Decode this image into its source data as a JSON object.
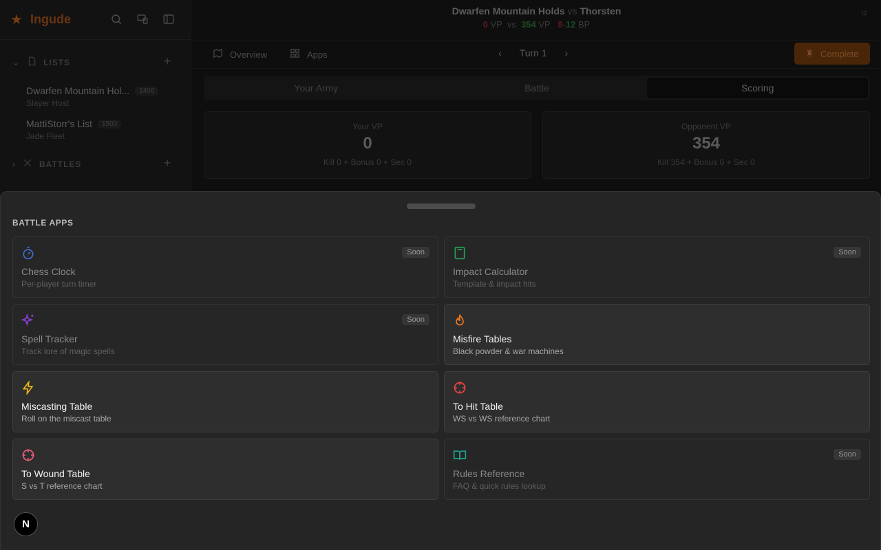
{
  "app": {
    "name": "Ingude"
  },
  "sidebar": {
    "lists_label": "LISTS",
    "battles_label": "BATTLES",
    "lists": [
      {
        "name": "Dwarfen Mountain Hol...",
        "points": "1400",
        "sub": "Slayer Host"
      },
      {
        "name": "MattiStorr's List",
        "points": "1500",
        "sub": "Jade Fleet"
      }
    ]
  },
  "match": {
    "player": "Dwarfen Mountain Holds",
    "vs": "vs",
    "opponent": "Thorsten",
    "your_vp": "0",
    "vp_unit": "VP",
    "vs_small": "vs",
    "opp_vp": "354",
    "bp_left": "8",
    "bp_sep": "-",
    "bp_right": "12",
    "bp_unit": "BP"
  },
  "toolbar": {
    "overview": "Overview",
    "apps": "Apps",
    "turn": "Turn 1",
    "complete": "Complete"
  },
  "tabs": [
    "Your Army",
    "Battle",
    "Scoring"
  ],
  "scoring": {
    "your_label": "Your VP",
    "your_value": "0",
    "your_break": "Kill 0 + Bonus 0 + Sec 0",
    "opp_label": "Opponent VP",
    "opp_value": "354",
    "opp_break": "Kill 354 + Bonus 0 + Sec 0"
  },
  "sheet": {
    "title": "BATTLE APPS",
    "soon_label": "Soon",
    "apps": [
      {
        "title": "Chess Clock",
        "sub": "Per-player turn timer",
        "icon": "stopwatch-icon",
        "color": "#3b6fd8",
        "soon": true
      },
      {
        "title": "Impact Calculator",
        "sub": "Template & impact hits",
        "icon": "calculator-icon",
        "color": "#22a355",
        "soon": true
      },
      {
        "title": "Spell Tracker",
        "sub": "Track lore of magic spells",
        "icon": "sparkles-icon",
        "color": "#8a3fd0",
        "soon": true
      },
      {
        "title": "Misfire Tables",
        "sub": "Black powder & war machines",
        "icon": "flame-icon",
        "color": "#f07a1e",
        "soon": false
      },
      {
        "title": "Miscasting Table",
        "sub": "Roll on the miscast table",
        "icon": "lightning-icon",
        "color": "#f0b81a",
        "soon": false
      },
      {
        "title": "To Hit Table",
        "sub": "WS vs WS reference chart",
        "icon": "crosshair-icon",
        "color": "#ef4444",
        "soon": false
      },
      {
        "title": "To Wound Table",
        "sub": "S vs T reference chart",
        "icon": "crosshair-icon",
        "color": "#f0607a",
        "soon": false
      },
      {
        "title": "Rules Reference",
        "sub": "FAQ & quick rules lookup",
        "icon": "book-icon",
        "color": "#1fa38c",
        "soon": true
      }
    ]
  },
  "dev_badge": "N"
}
